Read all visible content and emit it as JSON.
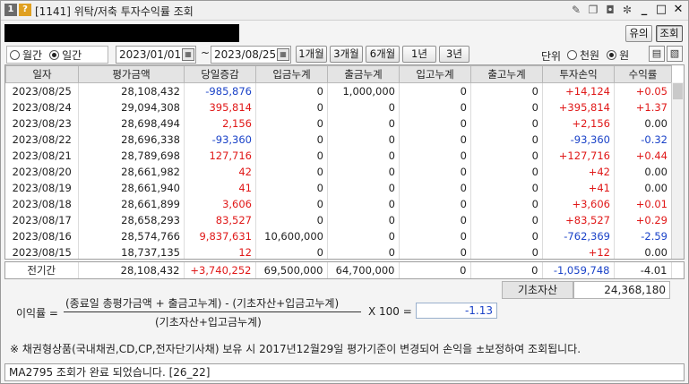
{
  "window": {
    "screen_no": "[1141]",
    "title": "위탁/저축 투자수익률 조회",
    "tool_icons": [
      "✎",
      "❐",
      "◘",
      "✼",
      "_",
      "□",
      "✕"
    ]
  },
  "buttons": {
    "notice": "유의",
    "query": "조회"
  },
  "filter": {
    "period_options": [
      {
        "label": "월간",
        "selected": false
      },
      {
        "label": "일간",
        "selected": true
      }
    ],
    "start_date": "2023/01/01",
    "tilde": "~",
    "end_date": "2023/08/25",
    "quick_ranges": [
      "1개월",
      "3개월",
      "6개월",
      "1년",
      "3년"
    ],
    "unit_label": "단위",
    "unit_options": [
      {
        "label": "천원",
        "selected": false
      },
      {
        "label": "원",
        "selected": true
      }
    ]
  },
  "table": {
    "columns": [
      "일자",
      "평가금액",
      "당일증감",
      "입금누계",
      "출금누계",
      "입고누계",
      "출고누계",
      "투자손익",
      "수익률"
    ],
    "rows": [
      [
        "2023/08/25",
        "28,108,432",
        "-985,876",
        "0",
        "1,000,000",
        "0",
        "0",
        "+14,124",
        "+0.05"
      ],
      [
        "2023/08/24",
        "29,094,308",
        "395,814",
        "0",
        "0",
        "0",
        "0",
        "+395,814",
        "+1.37"
      ],
      [
        "2023/08/23",
        "28,698,494",
        "2,156",
        "0",
        "0",
        "0",
        "0",
        "+2,156",
        "0.00"
      ],
      [
        "2023/08/22",
        "28,696,338",
        "-93,360",
        "0",
        "0",
        "0",
        "0",
        "-93,360",
        "-0.32"
      ],
      [
        "2023/08/21",
        "28,789,698",
        "127,716",
        "0",
        "0",
        "0",
        "0",
        "+127,716",
        "+0.44"
      ],
      [
        "2023/08/20",
        "28,661,982",
        "42",
        "0",
        "0",
        "0",
        "0",
        "+42",
        "0.00"
      ],
      [
        "2023/08/19",
        "28,661,940",
        "41",
        "0",
        "0",
        "0",
        "0",
        "+41",
        "0.00"
      ],
      [
        "2023/08/18",
        "28,661,899",
        "3,606",
        "0",
        "0",
        "0",
        "0",
        "+3,606",
        "+0.01"
      ],
      [
        "2023/08/17",
        "28,658,293",
        "83,527",
        "0",
        "0",
        "0",
        "0",
        "+83,527",
        "+0.29"
      ],
      [
        "2023/08/16",
        "28,574,766",
        "9,837,631",
        "10,600,000",
        "0",
        "0",
        "0",
        "-762,369",
        "-2.59"
      ],
      [
        "2023/08/15",
        "18,737,135",
        "12",
        "0",
        "0",
        "0",
        "0",
        "+12",
        "0.00"
      ]
    ],
    "total": [
      "전기간",
      "28,108,432",
      "+3,740,252",
      "69,500,000",
      "64,700,000",
      "0",
      "0",
      "-1,059,748",
      "-4.01"
    ]
  },
  "formula": {
    "base_asset_label": "기초자산",
    "base_asset_value": "24,368,180",
    "rate_label": "이익률 =",
    "numerator": "(종료일 총평가금액 + 출금고누계) - (기초자산+입금고누계)",
    "denominator": "(기초자산+입고금누계)",
    "multiplier": "X 100 =",
    "result": "-1.13"
  },
  "notice": "※ 채권형상품(국내채권,CD,CP,전자단기사채) 보유 시 2017년12월29일 평가기준이 변경되어 손익을 ±보정하여 조회됩니다.",
  "status": "MA2795 조회가 완료 되었습니다. [26_22]",
  "colors": {
    "positive": "#e01818",
    "negative": "#1b43c8"
  }
}
